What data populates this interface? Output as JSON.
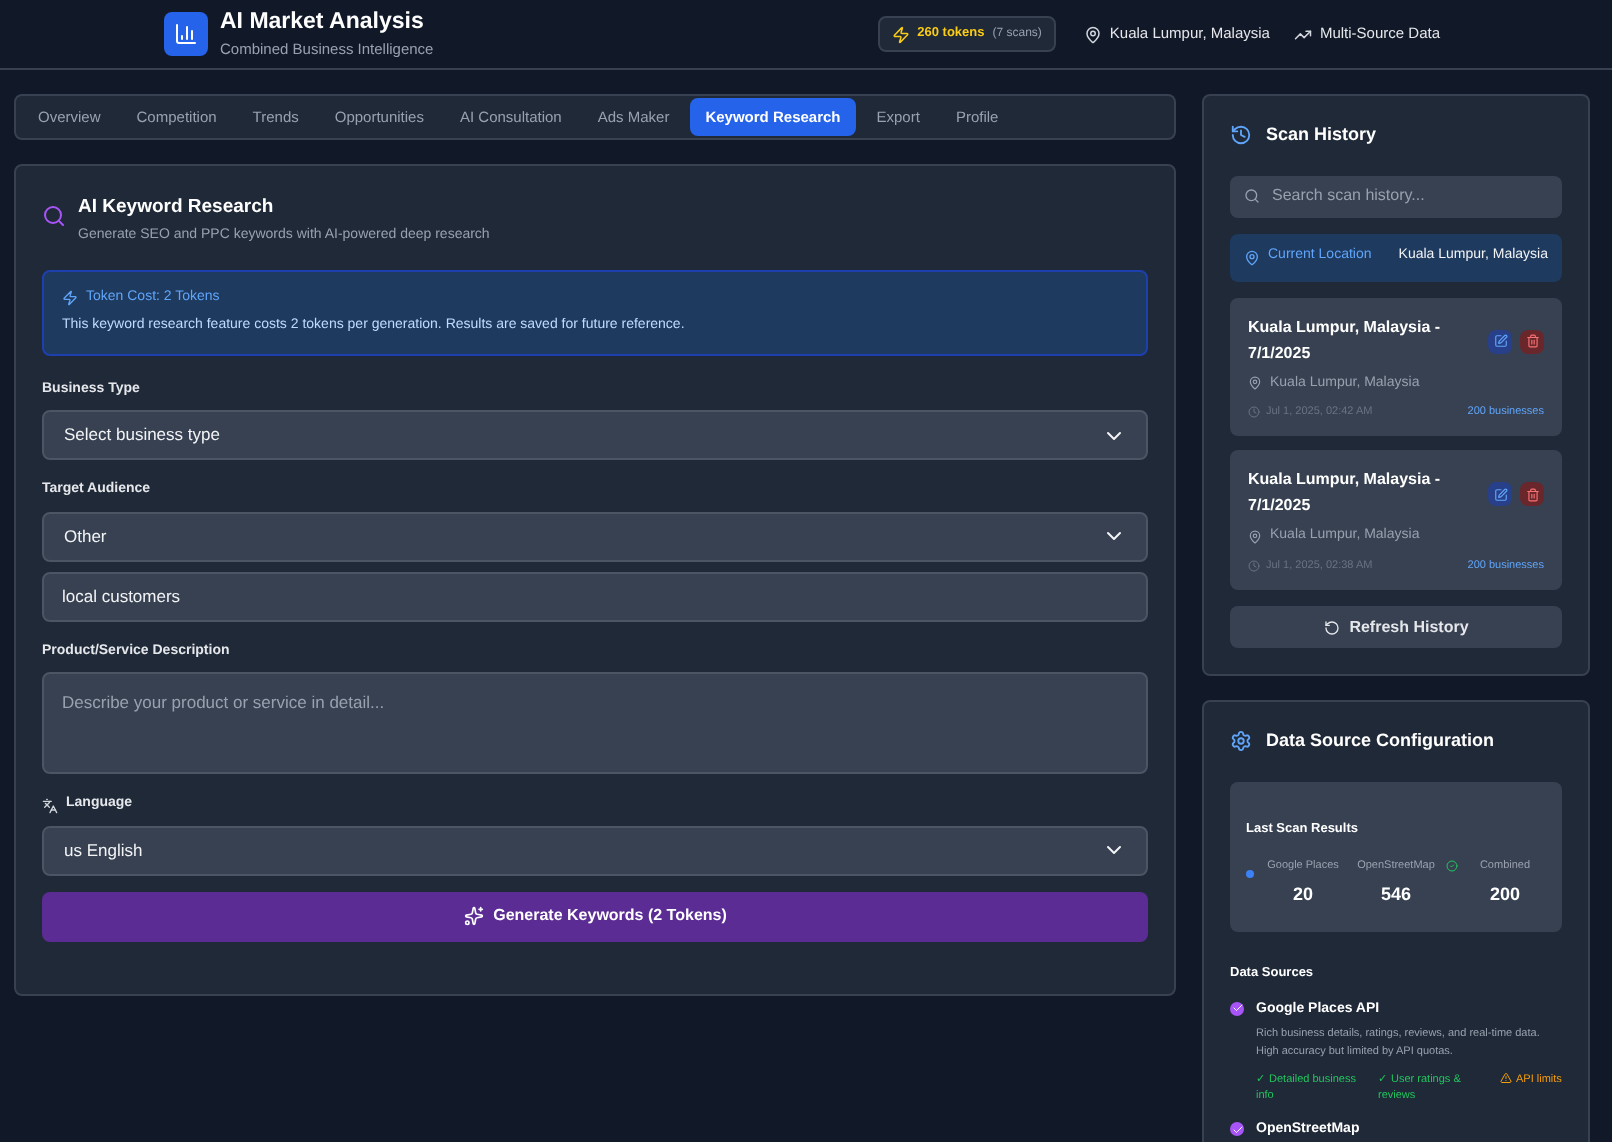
{
  "header": {
    "title": "AI Market Analysis",
    "subtitle": "Combined Business Intelligence",
    "tokens": "260 tokens",
    "scans": "(7 scans)",
    "location": "Kuala Lumpur, Malaysia",
    "data_mode": "Multi-Source Data"
  },
  "tabs": [
    {
      "label": "Overview",
      "selected": false
    },
    {
      "label": "Competition",
      "selected": false
    },
    {
      "label": "Trends",
      "selected": false
    },
    {
      "label": "Opportunities",
      "selected": false
    },
    {
      "label": "AI Consultation",
      "selected": false
    },
    {
      "label": "Ads Maker",
      "selected": false
    },
    {
      "label": "Keyword Research",
      "selected": true
    },
    {
      "label": "Export",
      "selected": false
    },
    {
      "label": "Profile",
      "selected": false
    }
  ],
  "keyword_research": {
    "title": "AI Keyword Research",
    "subtitle": "Generate SEO and PPC keywords with AI-powered deep research",
    "notice": {
      "title": "Token Cost: 2 Tokens",
      "text": "This keyword research feature costs 2 tokens per generation. Results are saved for future reference."
    },
    "fields": [
      {
        "kind": "plain",
        "label": "Business Type",
        "controls": [
          {
            "kind": "select",
            "value": "Select business type"
          }
        ]
      },
      {
        "kind": "plain",
        "label": "Target Audience",
        "controls": [
          {
            "kind": "select",
            "value": "Other"
          },
          {
            "kind": "input",
            "value": "local customers"
          }
        ]
      },
      {
        "kind": "plain",
        "label": "Product/Service Description",
        "controls": [
          {
            "kind": "textarea",
            "placeholder": "Describe your product or service in detail..."
          }
        ]
      },
      {
        "kind": "language",
        "label": "Language",
        "controls": [
          {
            "kind": "select",
            "value": "us English"
          }
        ]
      }
    ],
    "generate_button": "Generate Keywords (2 Tokens)"
  },
  "scan_history": {
    "title": "Scan History",
    "search": {
      "placeholder": "Search scan history..."
    },
    "current_location": {
      "label": "Current Location",
      "value": "Kuala Lumpur, Malaysia"
    },
    "entries": [
      {
        "title": "Kuala Lumpur, Malaysia - 7/1/2025",
        "location": "Kuala Lumpur, Malaysia",
        "time": "Jul 1, 2025, 02:42 AM",
        "businesses": "200 businesses"
      },
      {
        "title": "Kuala Lumpur, Malaysia - 7/1/2025",
        "location": "Kuala Lumpur, Malaysia",
        "time": "Jul 1, 2025, 02:38 AM",
        "businesses": "200 businesses"
      }
    ],
    "refresh_button": "Refresh History"
  },
  "data_source_config": {
    "title": "Data Source Configuration",
    "last_scan": {
      "title": "Last Scan Results",
      "stats": [
        {
          "kind": "dot",
          "label": "Google Places",
          "value": "20"
        },
        {
          "kind": "plain",
          "label": "OpenStreetMap",
          "value": "546"
        },
        {
          "kind": "check",
          "label": "Combined",
          "value": "200"
        }
      ]
    },
    "sources_label": "Data Sources",
    "sources": [
      {
        "name": "Google Places API",
        "checked": true,
        "description": "Rich business details, ratings, reviews, and real-time data. High accuracy but limited by API quotas.",
        "features": [
          {
            "kind": "pro",
            "text": "✓ Detailed business info"
          },
          {
            "kind": "pro",
            "text": "✓ User ratings & reviews"
          },
          {
            "kind": "con",
            "text": "API limits"
          }
        ]
      },
      {
        "name": "OpenStreetMap",
        "checked": true
      }
    ]
  }
}
